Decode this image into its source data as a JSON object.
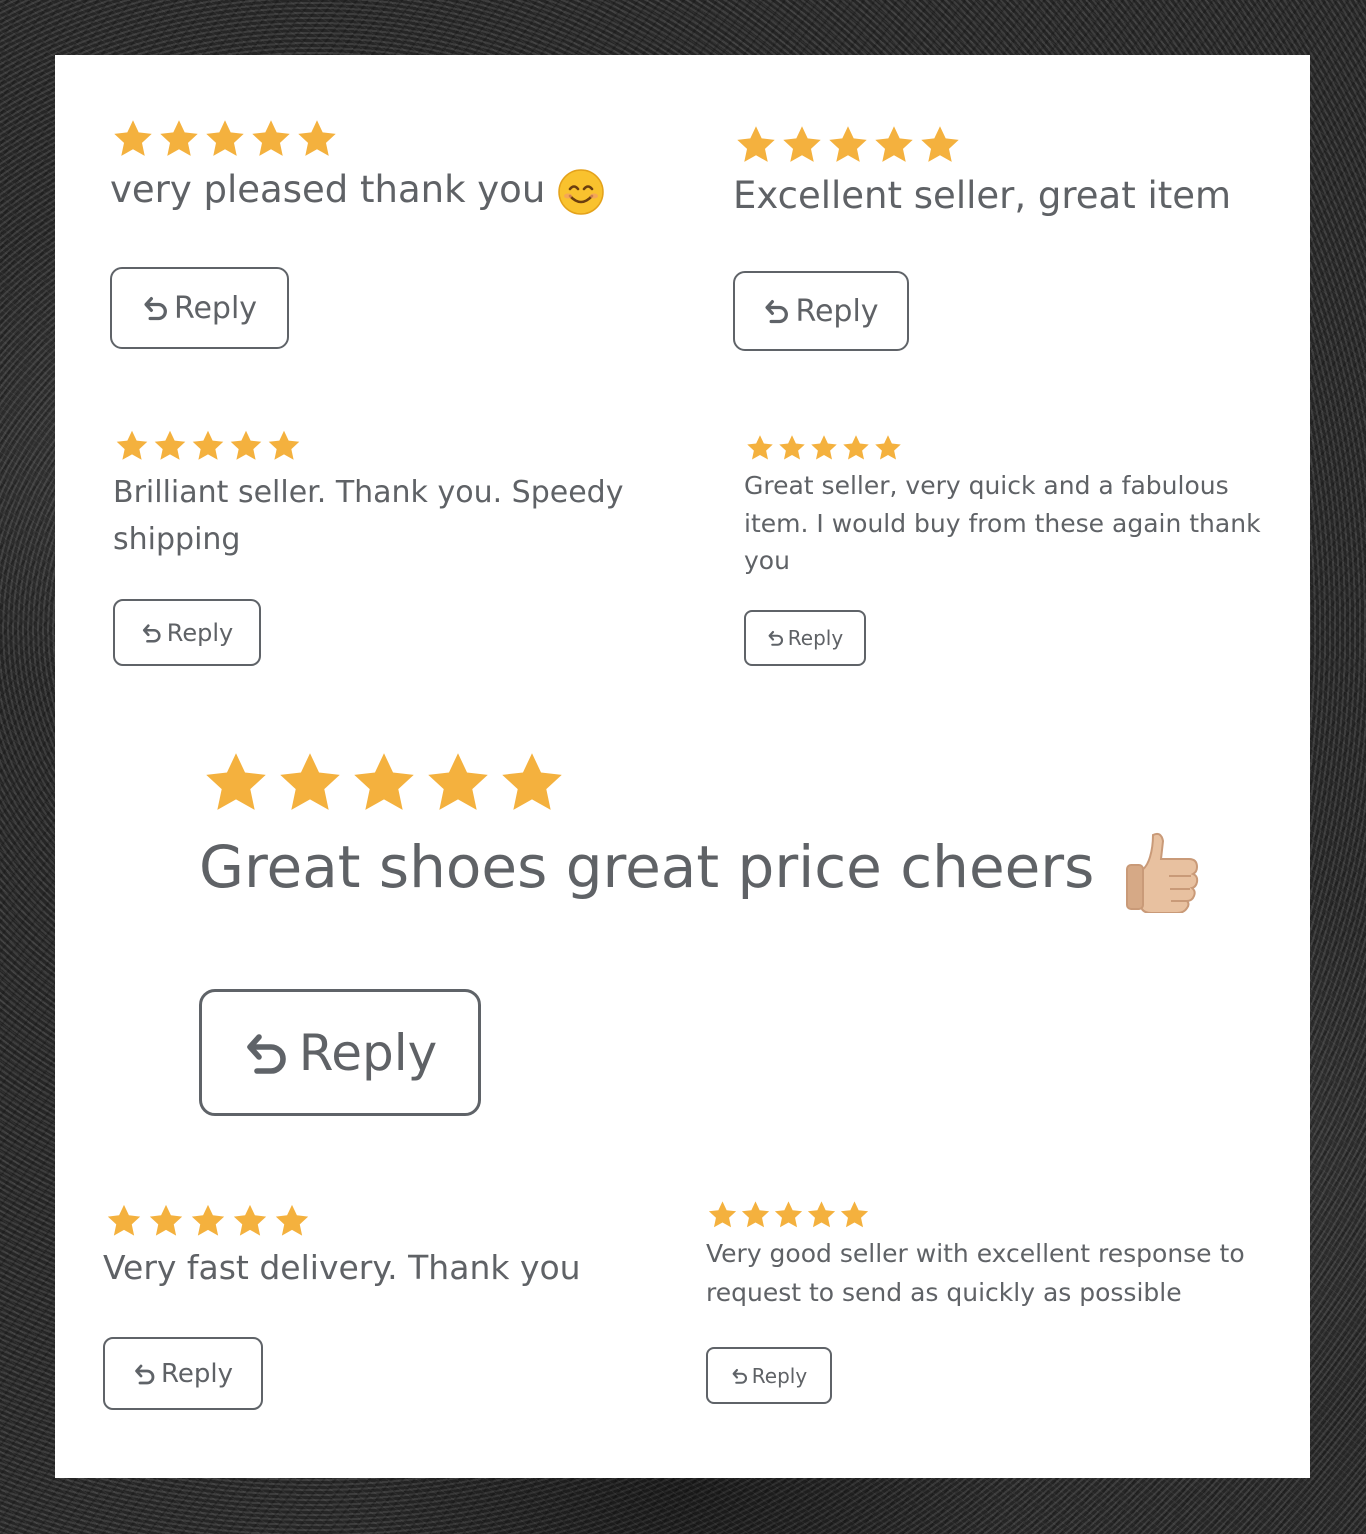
{
  "colors": {
    "star": "#f4b13e",
    "text": "#5f6266",
    "border": "#5f6368",
    "panel": "#ffffff"
  },
  "reviews": [
    {
      "rating": 5,
      "text": "very pleased thank you",
      "emoji": "smiling-face-emoji",
      "reply_label": "Reply"
    },
    {
      "rating": 5,
      "text": "Excellent seller, great item",
      "reply_label": "Reply"
    },
    {
      "rating": 5,
      "text": "Brilliant seller. Thank you. Speedy shipping",
      "reply_label": "Reply"
    },
    {
      "rating": 5,
      "text": "Great seller, very quick and a fabulous item. I would buy from these again thank you",
      "reply_label": "Reply"
    },
    {
      "rating": 5,
      "text": "Great shoes great price cheers",
      "emoji": "thumbs-up-emoji",
      "reply_label": "Reply"
    },
    {
      "rating": 5,
      "text": "Very fast delivery. Thank you",
      "reply_label": "Reply"
    },
    {
      "rating": 5,
      "text": "Very good seller with excellent response to request to send as quickly as possible",
      "reply_label": "Reply"
    }
  ]
}
